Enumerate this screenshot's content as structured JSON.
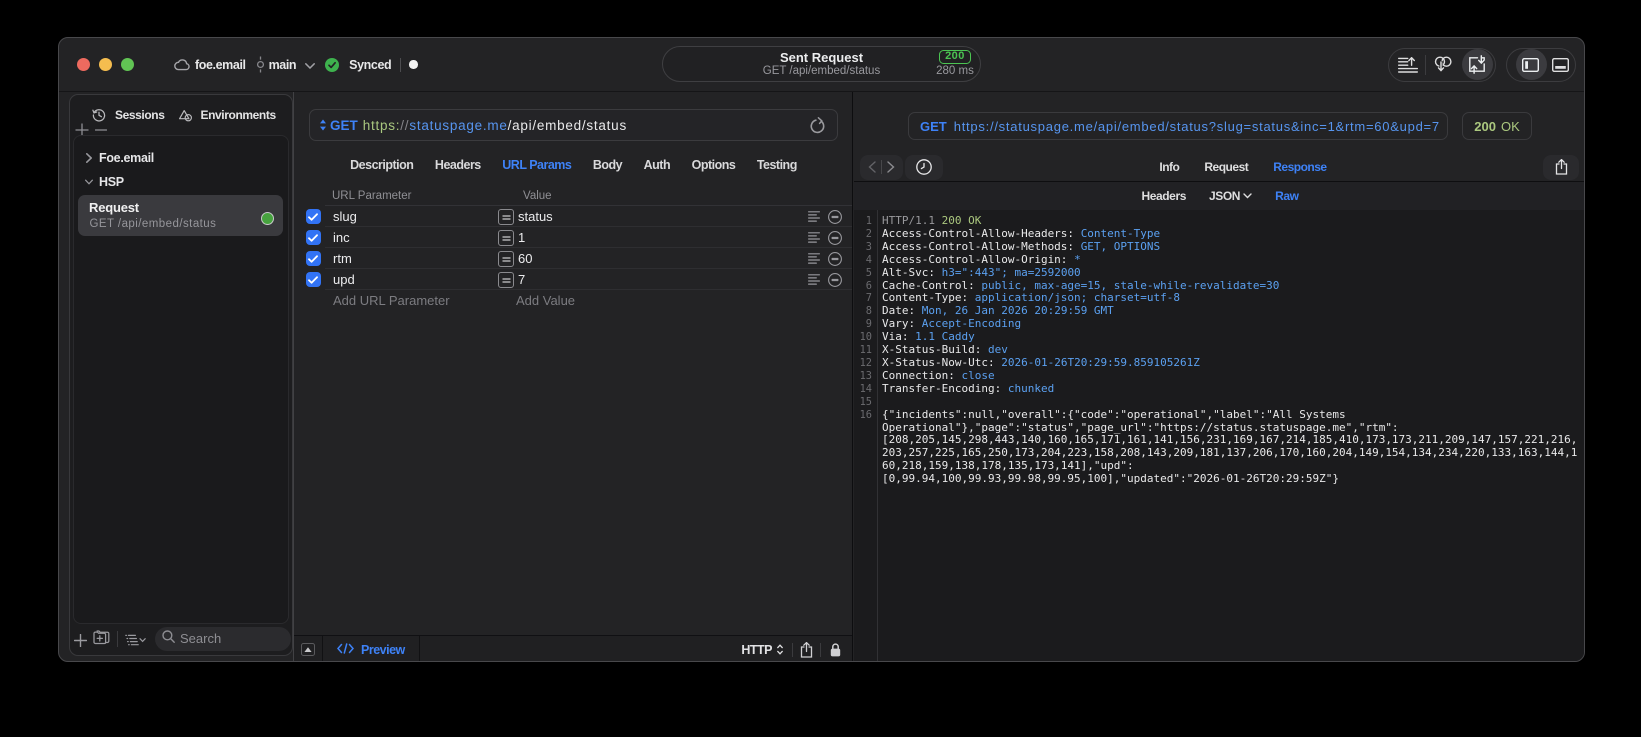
{
  "colors": {
    "accent": "#3e82f7",
    "badge-green": "#4bc452",
    "status-green": "#abc87f",
    "value-blue": "#5ba0f0",
    "scheme-green": "#a9c77f",
    "host-blue": "#5795ef"
  },
  "titlebar": {
    "project": "foe.email",
    "branch": "main",
    "sync_status": "Synced"
  },
  "status_pill": {
    "title": "Sent Request",
    "subtitle": "GET /api/embed/status",
    "status_code": "200",
    "duration": "280 ms"
  },
  "sidebar": {
    "tabs": [
      {
        "label": "Sessions",
        "icon": "history-icon"
      },
      {
        "label": "Environments",
        "icon": "environments-icon"
      }
    ],
    "tree": [
      {
        "label": "Foe.email",
        "state": "collapsed"
      },
      {
        "label": "HSP",
        "state": "expanded"
      }
    ],
    "selected_request": {
      "name": "Request",
      "method_path": "GET /api/embed/status"
    },
    "search_placeholder": "Search"
  },
  "request_editor": {
    "method": "GET",
    "url": {
      "scheme": "https:",
      "separator": "//",
      "host": "statuspage.me",
      "path": "/api/embed/status"
    },
    "tabs": [
      "Description",
      "Headers",
      "URL Params",
      "Body",
      "Auth",
      "Options",
      "Testing"
    ],
    "active_tab": "URL Params",
    "params_table": {
      "columns": [
        "URL Parameter",
        "Value"
      ],
      "rows": [
        {
          "enabled": true,
          "name": "slug",
          "value": "status"
        },
        {
          "enabled": true,
          "name": "inc",
          "value": "1"
        },
        {
          "enabled": true,
          "name": "rtm",
          "value": "60"
        },
        {
          "enabled": true,
          "name": "upd",
          "value": "7"
        }
      ],
      "add_name_placeholder": "Add URL Parameter",
      "add_value_placeholder": "Add Value"
    },
    "footer": {
      "preview_label": "Preview",
      "protocol": "HTTP"
    }
  },
  "response_viewer": {
    "method": "GET",
    "url": "https://statuspage.me/api/embed/status?slug=status&inc=1&rtm=60&upd=7",
    "status_code": "200",
    "status_text": "OK",
    "tabs": [
      "Info",
      "Request",
      "Response"
    ],
    "active_tab": "Response",
    "subtabs": [
      "Headers",
      "JSON",
      "Raw"
    ],
    "active_subtab": "Raw",
    "raw_lines": [
      {
        "num": "1",
        "seg": [
          [
            "HTTP/1.1 ",
            "dim"
          ],
          [
            "200 OK",
            "grn"
          ]
        ]
      },
      {
        "num": "2",
        "seg": [
          [
            "Access-Control-Allow-Headers: ",
            "wht"
          ],
          [
            "Content-Type",
            "blu"
          ]
        ]
      },
      {
        "num": "3",
        "seg": [
          [
            "Access-Control-Allow-Methods: ",
            "wht"
          ],
          [
            "GET, OPTIONS",
            "blu"
          ]
        ]
      },
      {
        "num": "4",
        "seg": [
          [
            "Access-Control-Allow-Origin: ",
            "wht"
          ],
          [
            "*",
            "blu"
          ]
        ]
      },
      {
        "num": "5",
        "seg": [
          [
            "Alt-Svc: ",
            "wht"
          ],
          [
            "h3=\":443\"; ma=2592000",
            "blu"
          ]
        ]
      },
      {
        "num": "6",
        "seg": [
          [
            "Cache-Control: ",
            "wht"
          ],
          [
            "public, max-age=15, stale-while-revalidate=30",
            "blu"
          ]
        ]
      },
      {
        "num": "7",
        "seg": [
          [
            "Content-Type: ",
            "wht"
          ],
          [
            "application/json; charset=utf-8",
            "blu"
          ]
        ]
      },
      {
        "num": "8",
        "seg": [
          [
            "Date: ",
            "wht"
          ],
          [
            "Mon, 26 Jan 2026 20:29:59 GMT",
            "blu"
          ]
        ]
      },
      {
        "num": "9",
        "seg": [
          [
            "Vary: ",
            "wht"
          ],
          [
            "Accept-Encoding",
            "blu"
          ]
        ]
      },
      {
        "num": "10",
        "seg": [
          [
            "Via: ",
            "wht"
          ],
          [
            "1.1 Caddy",
            "blu"
          ]
        ]
      },
      {
        "num": "11",
        "seg": [
          [
            "X-Status-Build: ",
            "wht"
          ],
          [
            "dev",
            "blu"
          ]
        ]
      },
      {
        "num": "12",
        "seg": [
          [
            "X-Status-Now-Utc: ",
            "wht"
          ],
          [
            "2026-01-26T20:29:59.859105261Z",
            "blu"
          ]
        ]
      },
      {
        "num": "13",
        "seg": [
          [
            "Connection: ",
            "wht"
          ],
          [
            "close",
            "blu"
          ]
        ]
      },
      {
        "num": "14",
        "seg": [
          [
            "Transfer-Encoding: ",
            "wht"
          ],
          [
            "chunked",
            "blu"
          ]
        ]
      },
      {
        "num": "15",
        "seg": []
      },
      {
        "num": "16",
        "seg": [
          [
            "{\"incidents\":null,\"overall\":{\"code\":\"operational\",\"label\":\"All Systems",
            "wht"
          ]
        ]
      },
      {
        "num": "",
        "seg": [
          [
            "Operational\"},\"page\":\"status\",\"page_url\":\"https://status.statuspage.me\",\"rtm\":",
            "wht"
          ]
        ]
      },
      {
        "num": "",
        "seg": [
          [
            "[208,205,145,298,443,140,160,165,171,161,141,156,231,169,167,214,185,410,173,173,211,209,147,157,221,216,",
            "wht"
          ]
        ]
      },
      {
        "num": "",
        "seg": [
          [
            "203,257,225,165,250,173,204,223,158,208,143,209,181,137,206,170,160,204,149,154,134,234,220,133,163,144,1",
            "wht"
          ]
        ]
      },
      {
        "num": "",
        "seg": [
          [
            "60,218,159,138,178,135,173,141],\"upd\":",
            "wht"
          ]
        ]
      },
      {
        "num": "",
        "seg": [
          [
            "[0,99.94,100,99.93,99.98,99.95,100],\"updated\":\"2026-01-26T20:29:59Z\"}",
            "wht"
          ]
        ]
      }
    ]
  }
}
